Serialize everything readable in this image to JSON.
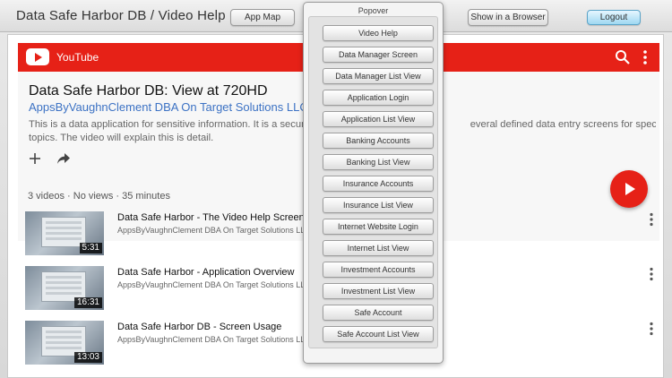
{
  "toolbar": {
    "title": "Data Safe Harbor DB / Video Help",
    "app_map_label": "App Map",
    "show_browser_label": "Show in a Browser",
    "logout_label": "Logout"
  },
  "youtube": {
    "brand": "YouTube",
    "video_title": "Data Safe Harbor DB: View at 720HD",
    "channel": "AppsByVaughnClement DBA On Target Solutions LLC",
    "description_line1": "This is a data application for sensitive information. It is a secure dat",
    "description_line1_end": "everal defined data entry screens for specific data",
    "description_line2": "topics. The video will explain this is detail.",
    "meta": "3 videos · No views · 35 minutes",
    "videos": [
      {
        "title": "Data Safe Harbor - The Video Help Screen",
        "channel": "AppsByVaughnClement DBA On Target Solutions LLC",
        "duration": "5:31"
      },
      {
        "title": "Data Safe Harbor - Application Overview",
        "channel": "AppsByVaughnClement DBA On Target Solutions LLC",
        "duration": "16:31"
      },
      {
        "title": "Data Safe Harbor DB - Screen Usage",
        "channel": "AppsByVaughnClement DBA On Target Solutions LLC",
        "duration": "13:03"
      }
    ]
  },
  "popover": {
    "title": "Popover",
    "items": [
      "Video Help",
      "Data Manager Screen",
      "Data Manager List View",
      "Application Login",
      "Application List View",
      "Banking Accounts",
      "Banking List View",
      "Insurance Accounts",
      "Insurance List View",
      "Internet Website Login",
      "Internet List View",
      "Investment Accounts",
      "Investment List View",
      "Safe Account",
      "Safe Account List View"
    ]
  },
  "colors": {
    "youtube_red": "#e62117",
    "channel_link": "#3c72c4",
    "logout_blue": "#9fd8f2"
  },
  "icons": [
    "youtube-logo-icon",
    "search-icon",
    "more-vert-icon",
    "add-icon",
    "share-icon",
    "play-icon"
  ]
}
